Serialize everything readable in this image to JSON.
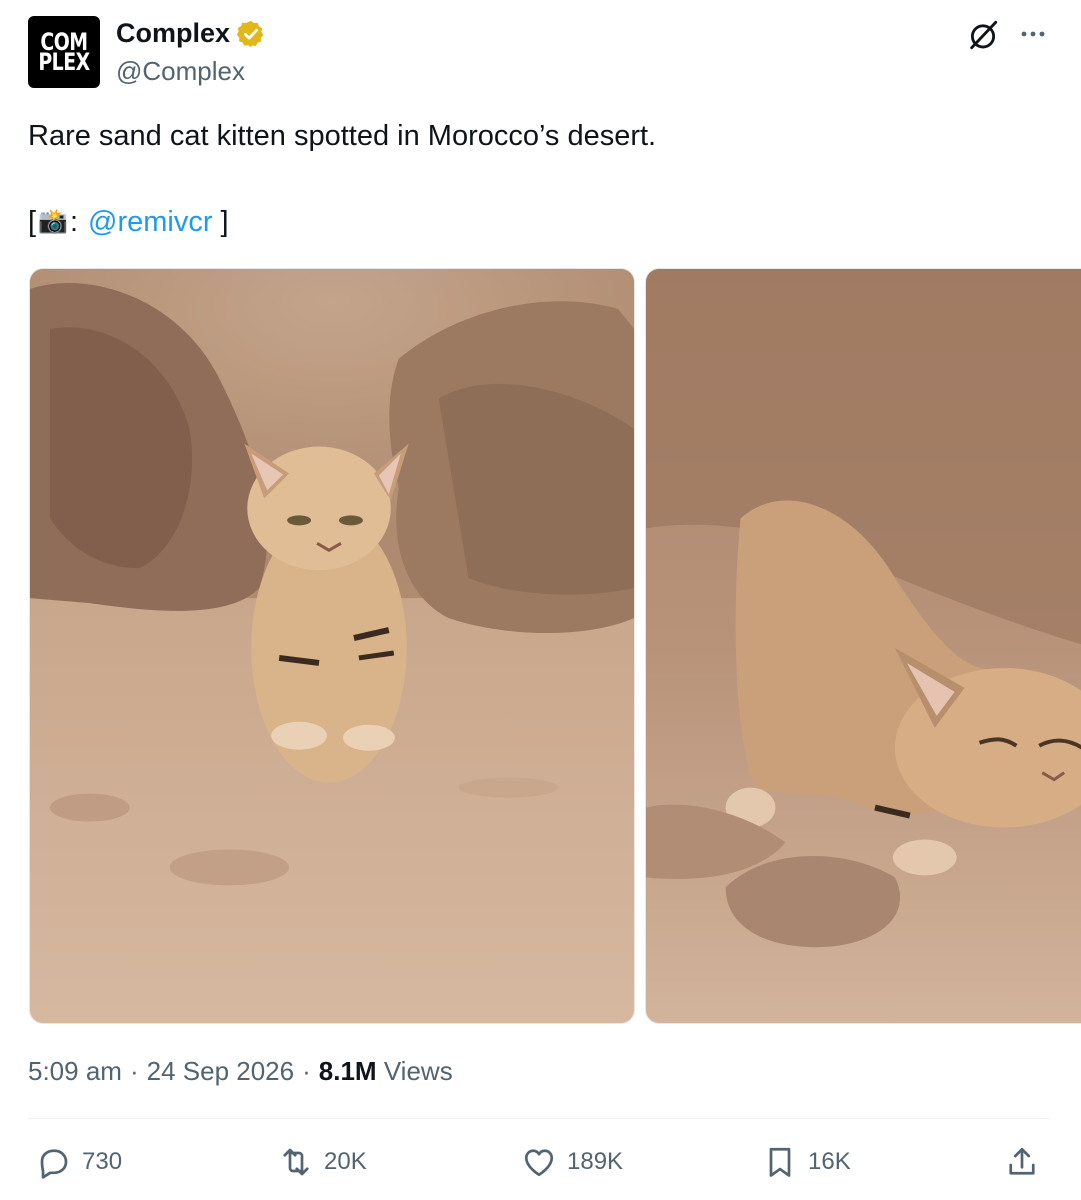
{
  "author": {
    "avatar_text_top": "COM",
    "avatar_text_bottom": "PLEX",
    "display_name": "Complex",
    "handle": "@Complex",
    "verified_color": "#e2b719"
  },
  "tweet": {
    "text": "Rare sand cat kitten spotted in Morocco’s desert.",
    "credit_open": "[",
    "credit_emoji": "📸",
    "credit_colon": ":",
    "mention": "@remivcr",
    "credit_close": "]"
  },
  "photos": [
    {
      "icon": "sand-cat-kitten-sitting-photo"
    },
    {
      "icon": "sand-cat-kitten-stretching-photo"
    }
  ],
  "meta": {
    "time": "5:09 am",
    "sep1": "·",
    "date": "24 Sep 2026",
    "sep2": "·",
    "views_count": "8.1M",
    "views_label": "Views"
  },
  "actions": {
    "replies": "730",
    "reposts": "20K",
    "likes": "189K",
    "bookmarks": "16K"
  },
  "colors": {
    "text": "#0f1419",
    "secondary": "#536471",
    "link": "#1d9bf0"
  }
}
